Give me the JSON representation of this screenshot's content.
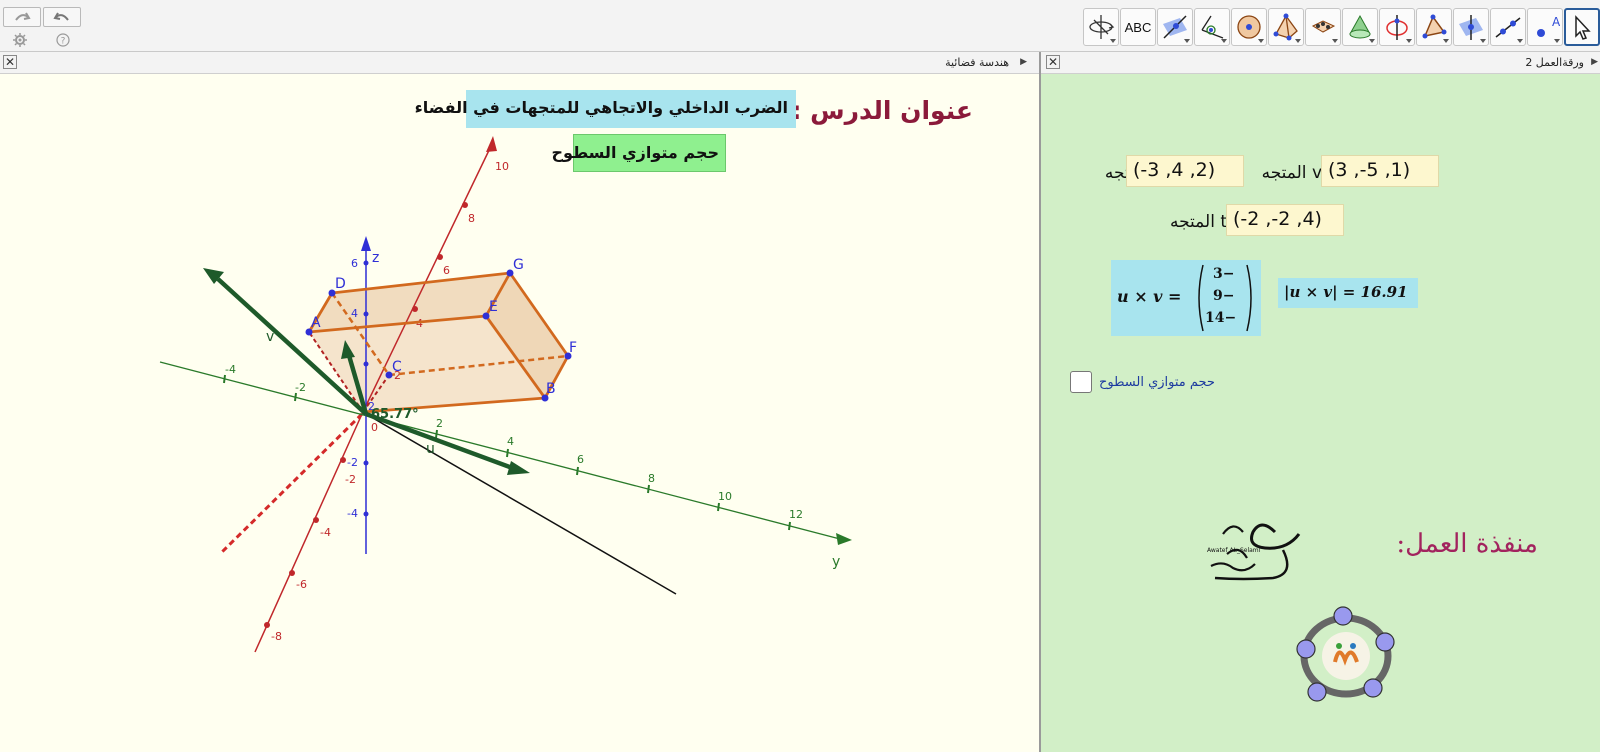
{
  "toolbar": {
    "undo_label": "undo",
    "redo_label": "redo",
    "tools": [
      {
        "name": "move-tool-icon",
        "selected": true
      },
      {
        "name": "point-tool-icon"
      },
      {
        "name": "line-tool-icon"
      },
      {
        "name": "perpendicular-line-tool-icon"
      },
      {
        "name": "polygon-tool-icon"
      },
      {
        "name": "circle-axis-tool-icon"
      },
      {
        "name": "cone-tool-icon"
      },
      {
        "name": "dice-net-tool-icon"
      },
      {
        "name": "pyramid-tool-icon"
      },
      {
        "name": "sphere-tool-icon"
      },
      {
        "name": "angle-tool-icon"
      },
      {
        "name": "reflect-tool-icon"
      },
      {
        "name": "text-tool-icon",
        "label": "ABC"
      },
      {
        "name": "rotate-view-tool-icon"
      }
    ]
  },
  "panels": {
    "view3d_title": "هندسة فضائية",
    "view2d_title": "ورقةالعمل 2"
  },
  "lesson": {
    "title_label": "عنوان الدرس :",
    "title_text": "الضرب الداخلي والاتجاهي للمتجهات في الفضاء",
    "subtitle": "حجم متوازي السطوح"
  },
  "graph3d": {
    "angle_label": "65.77°",
    "points": [
      "A",
      "B",
      "C",
      "D",
      "E",
      "F",
      "G"
    ],
    "vector_labels": [
      "u",
      "v"
    ],
    "axis_labels": {
      "z": "z",
      "y": "y"
    },
    "ticks_x": [
      "10",
      "8",
      "6",
      "4",
      "2",
      "-2",
      "-4",
      "-6",
      "-8"
    ],
    "ticks_y": [
      "-4",
      "-2",
      "2",
      "4",
      "6",
      "8",
      "10",
      "12"
    ],
    "ticks_z": [
      "6",
      "4",
      "2",
      "-2",
      "-4"
    ],
    "origin": "0"
  },
  "sheet": {
    "u_label": "u المتجه",
    "u_value": "(-3 ,4 ,2)",
    "v_label": "v المتجه",
    "v_value": "(3 ,-5 ,1)",
    "t_label": "t المتجه",
    "t_value": "(-2 ,-2 ,4)",
    "cross_lhs": "u × v =",
    "cross_vals": [
      "3−",
      "9−",
      "14−"
    ],
    "norm_text": "|u × v| = 16.91",
    "checkbox_label": "حجم متوازي السطوح",
    "checkbox_checked": false,
    "author_label": "منفذة العمل:",
    "signature_small": "Awatef AL_Selami"
  },
  "colors": {
    "view3d_bg": "#fffff0",
    "view2d_bg": "#d2efc7",
    "title_bg": "#a8e4ee",
    "subtitle_bg": "#8ff08f",
    "field_bg": "#fdf7cf",
    "x_axis": "#c0282b",
    "y_axis": "#2a7a2a",
    "z_axis": "#2f2fd6",
    "vector": "#1e5a2a",
    "prism_edge": "#d2691e"
  }
}
